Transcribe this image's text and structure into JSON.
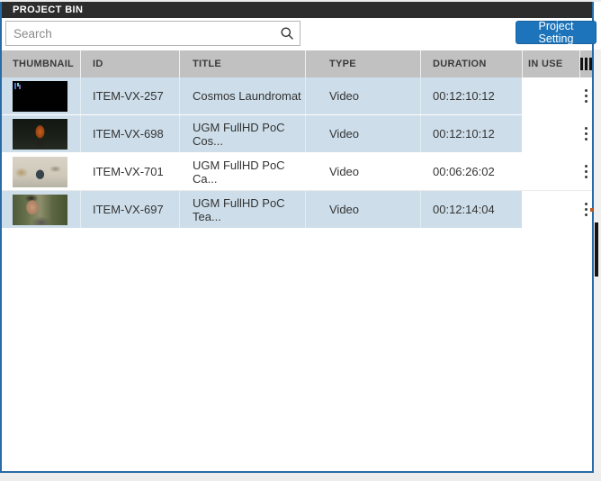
{
  "panel": {
    "title": "PROJECT BIN"
  },
  "toolbar": {
    "search": {
      "placeholder": "Search",
      "icon": "magnifier-icon"
    },
    "project_setting_button": "Project Setting"
  },
  "table": {
    "columns": {
      "thumbnail": "THUMBNAIL",
      "id": "ID",
      "title": "TITLE",
      "type": "TYPE",
      "duration": "DURATION",
      "in_use": "IN USE"
    },
    "column_chooser_icon": "column-chooser-icon",
    "row_menu_icon": "kebab-menu-icon",
    "rows": [
      {
        "thumbnail": "black-glyph",
        "id": "ITEM-VX-257",
        "title": "Cosmos Laundromat",
        "type": "Video",
        "duration": "00:12:10:12",
        "in_use": "",
        "selected": true
      },
      {
        "thumbnail": "orange-figure",
        "id": "ITEM-VX-698",
        "title": "UGM FullHD PoC Cos...",
        "type": "Video",
        "duration": "00:12:10:12",
        "in_use": "",
        "selected": true
      },
      {
        "thumbnail": "snow-animals",
        "id": "ITEM-VX-701",
        "title": "UGM FullHD PoC Ca...",
        "type": "Video",
        "duration": "00:06:26:02",
        "in_use": "",
        "selected": false
      },
      {
        "thumbnail": "man-face",
        "id": "ITEM-VX-697",
        "title": "UGM FullHD PoC Tea...",
        "type": "Video",
        "duration": "00:12:14:04",
        "in_use": "",
        "selected": true
      }
    ]
  },
  "colors": {
    "accent_border_blue": "#2a6ba6",
    "button_blue": "#1e74ba",
    "titlebar_dark": "#2d2d2d",
    "selected_row_blue": "#cddeea",
    "header_gray": "#c1c1c1",
    "scrollbar_thumb": "#141414",
    "scroll_marker_orange": "#c05a1e"
  }
}
